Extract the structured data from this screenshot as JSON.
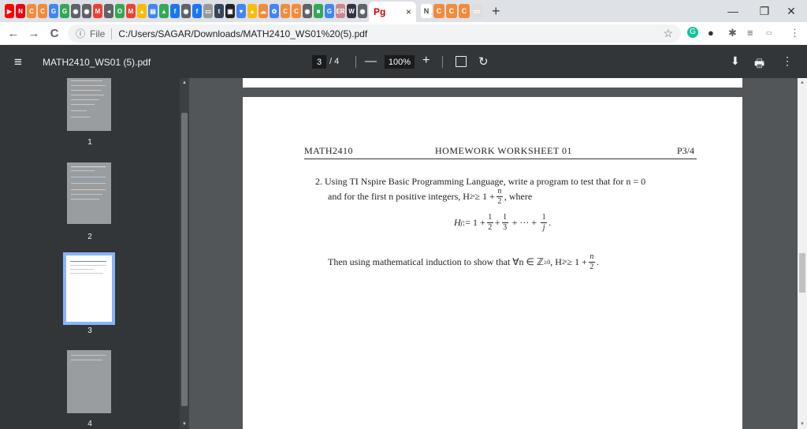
{
  "browser": {
    "tab_icons": [
      "youtube-icon",
      "netflix-icon",
      "c-icon",
      "c-icon",
      "google-icon",
      "g-icon",
      "chrome-icon",
      "chrome-icon",
      "gmail-icon",
      "audio-icon",
      "opera-icon",
      "gmail-icon",
      "drive-icon",
      "docs-icon",
      "drive-icon",
      "facebook-icon",
      "chrome-icon",
      "facebook-icon",
      "generic-icon",
      "tumblr-icon",
      "dark-icon",
      "heart-icon",
      "drive-icon",
      "cloud-icon",
      "gear-icon",
      "c-icon",
      "c-icon",
      "chrome-icon",
      "green-icon",
      "google-icon",
      "er-icon",
      "w-icon",
      "chrome-icon"
    ],
    "tab_icon_labels": [
      "▶",
      "N",
      "C",
      "C",
      "G",
      "G",
      "◉",
      "◉",
      "M",
      "◂",
      "O",
      "M",
      "▲",
      "▤",
      "▲",
      "f",
      "◉",
      "f",
      "▭",
      "t",
      "▣",
      "♥",
      "▲",
      "☁",
      "✿",
      "C",
      "C",
      "◉",
      "■",
      "G",
      "ER",
      "W",
      "◉"
    ],
    "active_tab_label": "Pg",
    "active_tab_close": "×",
    "after_tabs_labels": [
      "N",
      "C",
      "C",
      "C",
      "▭"
    ],
    "new_tab": "+",
    "window_minimize": "—",
    "window_restore": "❐",
    "window_close": "✕",
    "address": {
      "info_icon": "ⓘ",
      "scheme": "File",
      "url": "C:/Users/SAGAR/Downloads/MATH2410_WS01%20(5).pdf",
      "star": "☆"
    },
    "back": "←",
    "forward": "→",
    "reload": "C"
  },
  "pdf_toolbar": {
    "menu": "≡",
    "title": "MATH2410_WS01 (5).pdf",
    "current_page": "3",
    "page_sep": "/ 4",
    "zoom_minus": "—",
    "zoom": "100%",
    "zoom_plus": "+",
    "rotate": "↻",
    "download": "⬇",
    "print": "🖶",
    "more": "⋮"
  },
  "sidebar": {
    "thumbnails": [
      {
        "label": "1"
      },
      {
        "label": "2"
      },
      {
        "label": "3"
      },
      {
        "label": "4"
      }
    ]
  },
  "page": {
    "header_left": "MATH2410",
    "header_center": "HOMEWORK WORKSHEET 01",
    "header_right": "P3/4",
    "problem_line1": "2. Using TI Nspire Basic Programming Language, write a program to test that for n = 0",
    "problem_line2_a": "and for the first n positive integers, H",
    "problem_line2_sub": "2ⁿ",
    "problem_line2_b": " ≥ 1 +",
    "problem_line2_frac_num": "n",
    "problem_line2_frac_den": "2",
    "problem_line2_c": ", where",
    "math_lhs": "H",
    "math_sub": "j",
    "math_assign": " := 1 +",
    "math_f1_num": "1",
    "math_f1_den": "2",
    "math_plus": "+",
    "math_f2_num": "1",
    "math_f2_den": "3",
    "math_dots": "+ ··· +",
    "math_f3_num": "1",
    "math_f3_den": "j",
    "math_end": ".",
    "then_text": "Then using mathematical induction to show that ∀n ∈ ℤ",
    "then_sup": "≥0",
    "then_mid": ", H",
    "then_sub": "2ⁿ",
    "then_ge": " ≥ 1 +",
    "then_frac_num": "n",
    "then_frac_den": "2",
    "then_end": "."
  }
}
